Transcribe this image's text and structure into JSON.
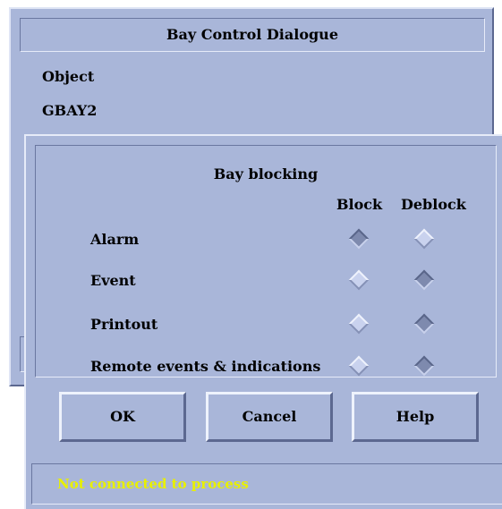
{
  "main_dialog": {
    "title": "Bay Control Dialogue",
    "object_label": "Object",
    "object_value": "GBAY2"
  },
  "block_dialog": {
    "title": "Bay blocking",
    "columns": [
      "Block",
      "Deblock"
    ],
    "rows": [
      {
        "label": "Alarm",
        "block_selected": true,
        "deblock_selected": false
      },
      {
        "label": "Event",
        "block_selected": false,
        "deblock_selected": true
      },
      {
        "label": "Printout",
        "block_selected": false,
        "deblock_selected": true
      },
      {
        "label": "Remote events & indications",
        "block_selected": false,
        "deblock_selected": true
      }
    ],
    "buttons": {
      "ok": "OK",
      "cancel": "Cancel",
      "help": "Help"
    },
    "status": "Not connected to process"
  },
  "colors": {
    "background": "#a9b6d9",
    "status_text": "#e8f000"
  }
}
